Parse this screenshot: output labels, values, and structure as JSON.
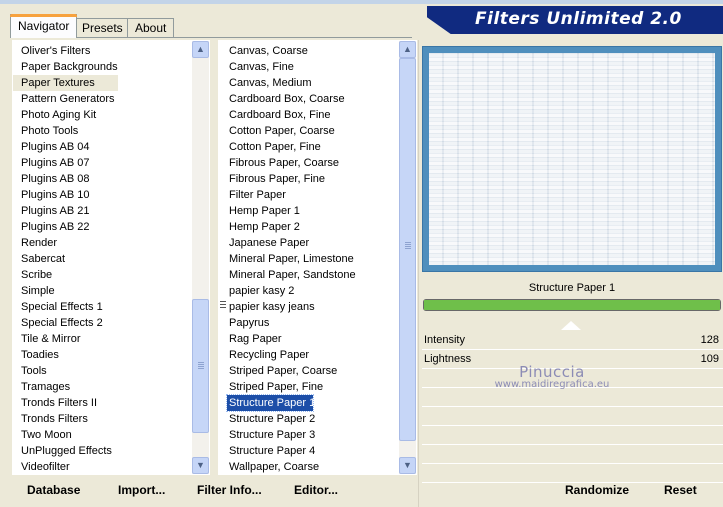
{
  "tabs": [
    {
      "label": "Navigator",
      "active": true
    },
    {
      "label": "Presets",
      "active": false
    },
    {
      "label": "About",
      "active": false
    }
  ],
  "title": "Filters Unlimited 2.0",
  "categories": [
    "Oliver's Filters",
    "Paper Backgrounds",
    "Paper Textures",
    "Pattern Generators",
    "Photo Aging Kit",
    "Photo Tools",
    "Plugins AB 04",
    "Plugins AB 07",
    "Plugins AB 08",
    "Plugins AB 10",
    "Plugins AB 21",
    "Plugins AB 22",
    "Render",
    "Sabercat",
    "Scribe",
    "Simple",
    "Special Effects 1",
    "Special Effects 2",
    "Tile & Mirror",
    "Toadies",
    "Tools",
    "Tramages",
    "Tronds Filters II",
    "Tronds Filters",
    "Two Moon",
    "UnPlugged Effects",
    "Videofilter"
  ],
  "selected_category": "Paper Textures",
  "filters": [
    "Canvas, Coarse",
    "Canvas, Fine",
    "Canvas, Medium",
    "Cardboard Box, Coarse",
    "Cardboard Box, Fine",
    "Cotton Paper, Coarse",
    "Cotton Paper, Fine",
    "Fibrous Paper, Coarse",
    "Fibrous Paper, Fine",
    "Filter Paper",
    "Hemp Paper 1",
    "Hemp Paper 2",
    "Japanese Paper",
    "Mineral Paper, Limestone",
    "Mineral Paper, Sandstone",
    "papier kasy 2",
    "papier kasy jeans",
    "Papyrus",
    "Rag Paper",
    "Recycling Paper",
    "Striped Paper, Coarse",
    "Striped Paper, Fine",
    "Structure Paper 1",
    "Structure Paper 2",
    "Structure Paper 3",
    "Structure Paper 4",
    "Wallpaper, Coarse"
  ],
  "selected_filter": "Structure Paper 1",
  "filter_name": "Structure Paper 1",
  "progress": 1.0,
  "params": [
    {
      "label": "Intensity",
      "value": "128"
    },
    {
      "label": "Lightness",
      "value": "109"
    }
  ],
  "watermark": {
    "name": "Pinuccia",
    "url": "www.maidiregrafica.eu"
  },
  "buttons": {
    "database": "Database",
    "import": "Import...",
    "filter_info": "Filter Info...",
    "editor": "Editor...",
    "randomize": "Randomize",
    "reset": "Reset"
  },
  "colors": {
    "title_banner": "#102a80",
    "selection": "#1c4ea8",
    "preview_border": "#4f8fbd",
    "progress": "#6fbf4a"
  },
  "icons": {
    "scroll_up": "up-arrow-icon",
    "scroll_down": "down-arrow-icon"
  }
}
